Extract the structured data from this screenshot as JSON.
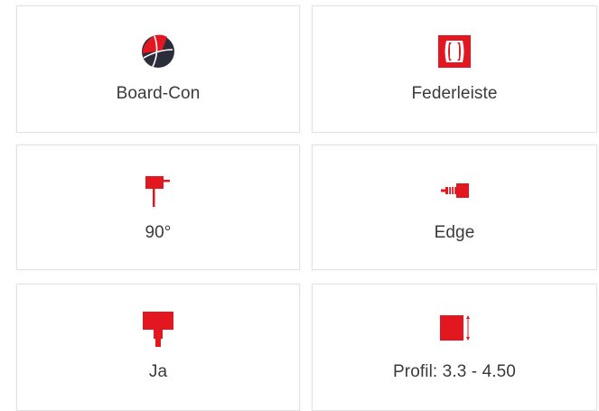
{
  "cards": [
    {
      "label": "Board-Con",
      "icon": "board-con-logo-icon"
    },
    {
      "label": "Federleiste",
      "icon": "spring-connector-icon"
    },
    {
      "label": "90°",
      "icon": "angle-90-icon"
    },
    {
      "label": "Edge",
      "icon": "edge-connector-icon"
    },
    {
      "label": "Ja",
      "icon": "yes-shape-icon"
    },
    {
      "label": "Profil: 3.3 - 4.50",
      "icon": "profile-dimension-icon"
    }
  ],
  "colors": {
    "accent": "#e3171f",
    "dark": "#2b2d3a",
    "text": "#3a3a3a",
    "border": "#e2e2e2"
  }
}
